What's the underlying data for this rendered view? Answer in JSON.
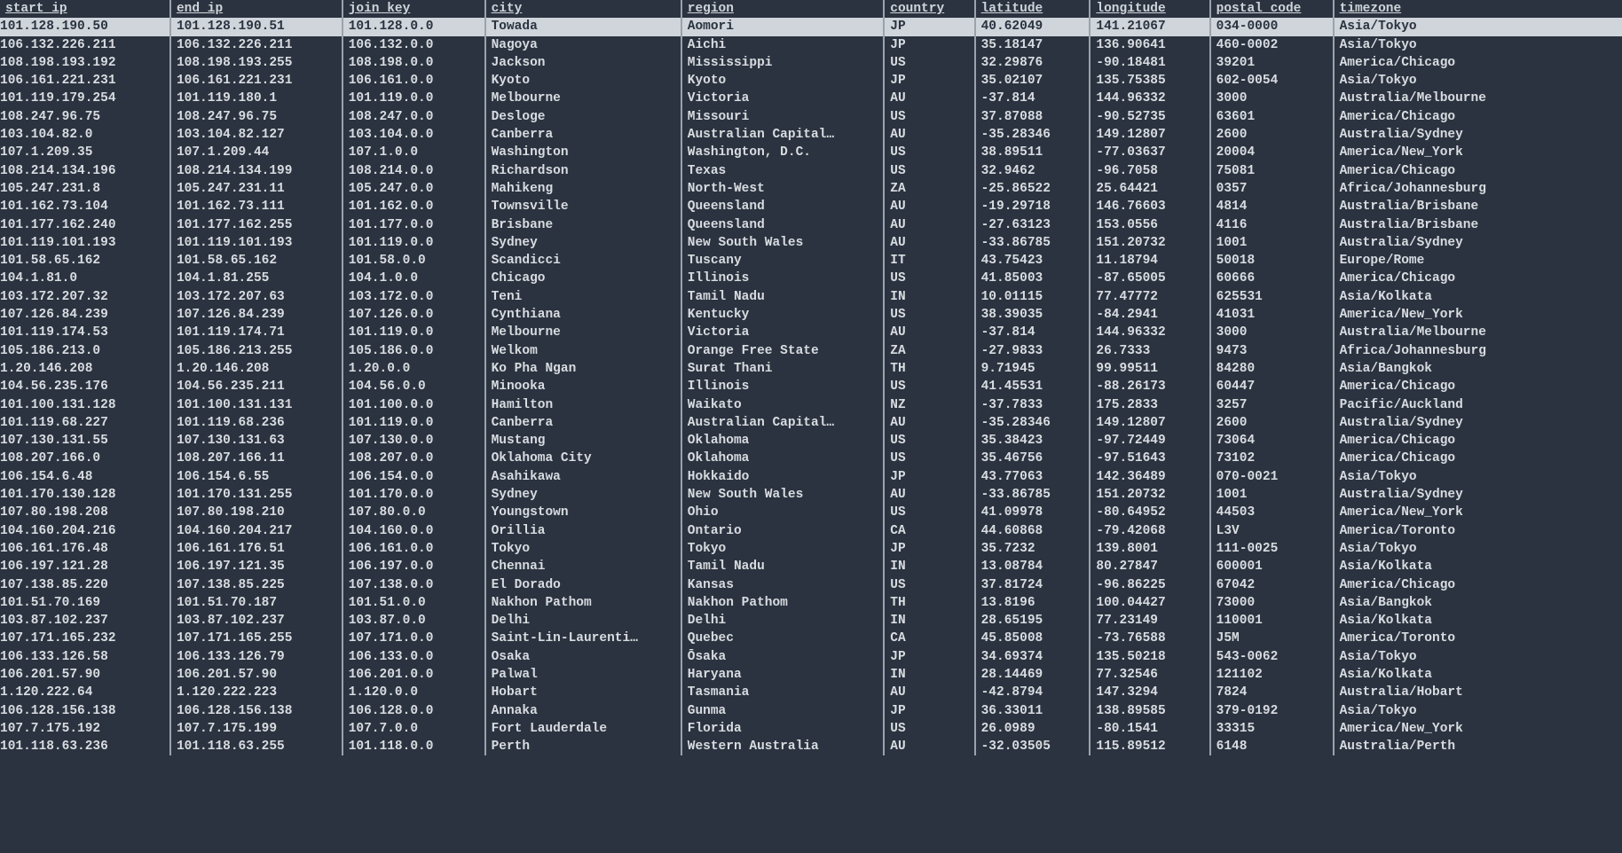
{
  "columns": [
    "start_ip",
    "end_ip",
    "join_key",
    "city",
    "region",
    "country",
    "latitude",
    "longitude",
    "postal_code",
    "timezone"
  ],
  "selected_index": 0,
  "rows": [
    {
      "start_ip": "101.128.190.50",
      "end_ip": "101.128.190.51",
      "join_key": "101.128.0.0",
      "city": "Towada",
      "region": "Aomori",
      "country": "JP",
      "latitude": "40.62049",
      "longitude": "141.21067",
      "postal_code": "034-0000",
      "timezone": "Asia/Tokyo"
    },
    {
      "start_ip": "106.132.226.211",
      "end_ip": "106.132.226.211",
      "join_key": "106.132.0.0",
      "city": "Nagoya",
      "region": "Aichi",
      "country": "JP",
      "latitude": "35.18147",
      "longitude": "136.90641",
      "postal_code": "460-0002",
      "timezone": "Asia/Tokyo"
    },
    {
      "start_ip": "108.198.193.192",
      "end_ip": "108.198.193.255",
      "join_key": "108.198.0.0",
      "city": "Jackson",
      "region": "Mississippi",
      "country": "US",
      "latitude": "32.29876",
      "longitude": "-90.18481",
      "postal_code": "39201",
      "timezone": "America/Chicago"
    },
    {
      "start_ip": "106.161.221.231",
      "end_ip": "106.161.221.231",
      "join_key": "106.161.0.0",
      "city": "Kyoto",
      "region": "Kyoto",
      "country": "JP",
      "latitude": "35.02107",
      "longitude": "135.75385",
      "postal_code": "602-0054",
      "timezone": "Asia/Tokyo"
    },
    {
      "start_ip": "101.119.179.254",
      "end_ip": "101.119.180.1",
      "join_key": "101.119.0.0",
      "city": "Melbourne",
      "region": "Victoria",
      "country": "AU",
      "latitude": "-37.814",
      "longitude": "144.96332",
      "postal_code": "3000",
      "timezone": "Australia/Melbourne"
    },
    {
      "start_ip": "108.247.96.75",
      "end_ip": "108.247.96.75",
      "join_key": "108.247.0.0",
      "city": "Desloge",
      "region": "Missouri",
      "country": "US",
      "latitude": "37.87088",
      "longitude": "-90.52735",
      "postal_code": "63601",
      "timezone": "America/Chicago"
    },
    {
      "start_ip": "103.104.82.0",
      "end_ip": "103.104.82.127",
      "join_key": "103.104.0.0",
      "city": "Canberra",
      "region": "Australian Capital…",
      "country": "AU",
      "latitude": "-35.28346",
      "longitude": "149.12807",
      "postal_code": "2600",
      "timezone": "Australia/Sydney"
    },
    {
      "start_ip": "107.1.209.35",
      "end_ip": "107.1.209.44",
      "join_key": "107.1.0.0",
      "city": "Washington",
      "region": "Washington, D.C.",
      "country": "US",
      "latitude": "38.89511",
      "longitude": "-77.03637",
      "postal_code": "20004",
      "timezone": "America/New_York"
    },
    {
      "start_ip": "108.214.134.196",
      "end_ip": "108.214.134.199",
      "join_key": "108.214.0.0",
      "city": "Richardson",
      "region": "Texas",
      "country": "US",
      "latitude": "32.9462",
      "longitude": "-96.7058",
      "postal_code": "75081",
      "timezone": "America/Chicago"
    },
    {
      "start_ip": "105.247.231.8",
      "end_ip": "105.247.231.11",
      "join_key": "105.247.0.0",
      "city": "Mahikeng",
      "region": "North-West",
      "country": "ZA",
      "latitude": "-25.86522",
      "longitude": "25.64421",
      "postal_code": "0357",
      "timezone": "Africa/Johannesburg"
    },
    {
      "start_ip": "101.162.73.104",
      "end_ip": "101.162.73.111",
      "join_key": "101.162.0.0",
      "city": "Townsville",
      "region": "Queensland",
      "country": "AU",
      "latitude": "-19.29718",
      "longitude": "146.76603",
      "postal_code": "4814",
      "timezone": "Australia/Brisbane"
    },
    {
      "start_ip": "101.177.162.240",
      "end_ip": "101.177.162.255",
      "join_key": "101.177.0.0",
      "city": "Brisbane",
      "region": "Queensland",
      "country": "AU",
      "latitude": "-27.63123",
      "longitude": "153.0556",
      "postal_code": "4116",
      "timezone": "Australia/Brisbane"
    },
    {
      "start_ip": "101.119.101.193",
      "end_ip": "101.119.101.193",
      "join_key": "101.119.0.0",
      "city": "Sydney",
      "region": "New South Wales",
      "country": "AU",
      "latitude": "-33.86785",
      "longitude": "151.20732",
      "postal_code": "1001",
      "timezone": "Australia/Sydney"
    },
    {
      "start_ip": "101.58.65.162",
      "end_ip": "101.58.65.162",
      "join_key": "101.58.0.0",
      "city": "Scandicci",
      "region": "Tuscany",
      "country": "IT",
      "latitude": "43.75423",
      "longitude": "11.18794",
      "postal_code": "50018",
      "timezone": "Europe/Rome"
    },
    {
      "start_ip": "104.1.81.0",
      "end_ip": "104.1.81.255",
      "join_key": "104.1.0.0",
      "city": "Chicago",
      "region": "Illinois",
      "country": "US",
      "latitude": "41.85003",
      "longitude": "-87.65005",
      "postal_code": "60666",
      "timezone": "America/Chicago"
    },
    {
      "start_ip": "103.172.207.32",
      "end_ip": "103.172.207.63",
      "join_key": "103.172.0.0",
      "city": "Teni",
      "region": "Tamil Nadu",
      "country": "IN",
      "latitude": "10.01115",
      "longitude": "77.47772",
      "postal_code": "625531",
      "timezone": "Asia/Kolkata"
    },
    {
      "start_ip": "107.126.84.239",
      "end_ip": "107.126.84.239",
      "join_key": "107.126.0.0",
      "city": "Cynthiana",
      "region": "Kentucky",
      "country": "US",
      "latitude": "38.39035",
      "longitude": "-84.2941",
      "postal_code": "41031",
      "timezone": "America/New_York"
    },
    {
      "start_ip": "101.119.174.53",
      "end_ip": "101.119.174.71",
      "join_key": "101.119.0.0",
      "city": "Melbourne",
      "region": "Victoria",
      "country": "AU",
      "latitude": "-37.814",
      "longitude": "144.96332",
      "postal_code": "3000",
      "timezone": "Australia/Melbourne"
    },
    {
      "start_ip": "105.186.213.0",
      "end_ip": "105.186.213.255",
      "join_key": "105.186.0.0",
      "city": "Welkom",
      "region": "Orange Free State",
      "country": "ZA",
      "latitude": "-27.9833",
      "longitude": "26.7333",
      "postal_code": "9473",
      "timezone": "Africa/Johannesburg"
    },
    {
      "start_ip": "1.20.146.208",
      "end_ip": "1.20.146.208",
      "join_key": "1.20.0.0",
      "city": "Ko Pha Ngan",
      "region": "Surat Thani",
      "country": "TH",
      "latitude": "9.71945",
      "longitude": "99.99511",
      "postal_code": "84280",
      "timezone": "Asia/Bangkok"
    },
    {
      "start_ip": "104.56.235.176",
      "end_ip": "104.56.235.211",
      "join_key": "104.56.0.0",
      "city": "Minooka",
      "region": "Illinois",
      "country": "US",
      "latitude": "41.45531",
      "longitude": "-88.26173",
      "postal_code": "60447",
      "timezone": "America/Chicago"
    },
    {
      "start_ip": "101.100.131.128",
      "end_ip": "101.100.131.131",
      "join_key": "101.100.0.0",
      "city": "Hamilton",
      "region": "Waikato",
      "country": "NZ",
      "latitude": "-37.7833",
      "longitude": "175.2833",
      "postal_code": "3257",
      "timezone": "Pacific/Auckland"
    },
    {
      "start_ip": "101.119.68.227",
      "end_ip": "101.119.68.236",
      "join_key": "101.119.0.0",
      "city": "Canberra",
      "region": "Australian Capital…",
      "country": "AU",
      "latitude": "-35.28346",
      "longitude": "149.12807",
      "postal_code": "2600",
      "timezone": "Australia/Sydney"
    },
    {
      "start_ip": "107.130.131.55",
      "end_ip": "107.130.131.63",
      "join_key": "107.130.0.0",
      "city": "Mustang",
      "region": "Oklahoma",
      "country": "US",
      "latitude": "35.38423",
      "longitude": "-97.72449",
      "postal_code": "73064",
      "timezone": "America/Chicago"
    },
    {
      "start_ip": "108.207.166.0",
      "end_ip": "108.207.166.11",
      "join_key": "108.207.0.0",
      "city": "Oklahoma City",
      "region": "Oklahoma",
      "country": "US",
      "latitude": "35.46756",
      "longitude": "-97.51643",
      "postal_code": "73102",
      "timezone": "America/Chicago"
    },
    {
      "start_ip": "106.154.6.48",
      "end_ip": "106.154.6.55",
      "join_key": "106.154.0.0",
      "city": "Asahikawa",
      "region": "Hokkaido",
      "country": "JP",
      "latitude": "43.77063",
      "longitude": "142.36489",
      "postal_code": "070-0021",
      "timezone": "Asia/Tokyo"
    },
    {
      "start_ip": "101.170.130.128",
      "end_ip": "101.170.131.255",
      "join_key": "101.170.0.0",
      "city": "Sydney",
      "region": "New South Wales",
      "country": "AU",
      "latitude": "-33.86785",
      "longitude": "151.20732",
      "postal_code": "1001",
      "timezone": "Australia/Sydney"
    },
    {
      "start_ip": "107.80.198.208",
      "end_ip": "107.80.198.210",
      "join_key": "107.80.0.0",
      "city": "Youngstown",
      "region": "Ohio",
      "country": "US",
      "latitude": "41.09978",
      "longitude": "-80.64952",
      "postal_code": "44503",
      "timezone": "America/New_York"
    },
    {
      "start_ip": "104.160.204.216",
      "end_ip": "104.160.204.217",
      "join_key": "104.160.0.0",
      "city": "Orillia",
      "region": "Ontario",
      "country": "CA",
      "latitude": "44.60868",
      "longitude": "-79.42068",
      "postal_code": "L3V",
      "timezone": "America/Toronto"
    },
    {
      "start_ip": "106.161.176.48",
      "end_ip": "106.161.176.51",
      "join_key": "106.161.0.0",
      "city": "Tokyo",
      "region": "Tokyo",
      "country": "JP",
      "latitude": "35.7232",
      "longitude": "139.8001",
      "postal_code": "111-0025",
      "timezone": "Asia/Tokyo"
    },
    {
      "start_ip": "106.197.121.28",
      "end_ip": "106.197.121.35",
      "join_key": "106.197.0.0",
      "city": "Chennai",
      "region": "Tamil Nadu",
      "country": "IN",
      "latitude": "13.08784",
      "longitude": "80.27847",
      "postal_code": "600001",
      "timezone": "Asia/Kolkata"
    },
    {
      "start_ip": "107.138.85.220",
      "end_ip": "107.138.85.225",
      "join_key": "107.138.0.0",
      "city": "El Dorado",
      "region": "Kansas",
      "country": "US",
      "latitude": "37.81724",
      "longitude": "-96.86225",
      "postal_code": "67042",
      "timezone": "America/Chicago"
    },
    {
      "start_ip": "101.51.70.169",
      "end_ip": "101.51.70.187",
      "join_key": "101.51.0.0",
      "city": "Nakhon Pathom",
      "region": "Nakhon Pathom",
      "country": "TH",
      "latitude": "13.8196",
      "longitude": "100.04427",
      "postal_code": "73000",
      "timezone": "Asia/Bangkok"
    },
    {
      "start_ip": "103.87.102.237",
      "end_ip": "103.87.102.237",
      "join_key": "103.87.0.0",
      "city": "Delhi",
      "region": "Delhi",
      "country": "IN",
      "latitude": "28.65195",
      "longitude": "77.23149",
      "postal_code": "110001",
      "timezone": "Asia/Kolkata"
    },
    {
      "start_ip": "107.171.165.232",
      "end_ip": "107.171.165.255",
      "join_key": "107.171.0.0",
      "city": "Saint-Lin-Laurenti…",
      "region": "Quebec",
      "country": "CA",
      "latitude": "45.85008",
      "longitude": "-73.76588",
      "postal_code": "J5M",
      "timezone": "America/Toronto"
    },
    {
      "start_ip": "106.133.126.58",
      "end_ip": "106.133.126.79",
      "join_key": "106.133.0.0",
      "city": "Osaka",
      "region": "Ōsaka",
      "country": "JP",
      "latitude": "34.69374",
      "longitude": "135.50218",
      "postal_code": "543-0062",
      "timezone": "Asia/Tokyo"
    },
    {
      "start_ip": "106.201.57.90",
      "end_ip": "106.201.57.90",
      "join_key": "106.201.0.0",
      "city": "Palwal",
      "region": "Haryana",
      "country": "IN",
      "latitude": "28.14469",
      "longitude": "77.32546",
      "postal_code": "121102",
      "timezone": "Asia/Kolkata"
    },
    {
      "start_ip": "1.120.222.64",
      "end_ip": "1.120.222.223",
      "join_key": "1.120.0.0",
      "city": "Hobart",
      "region": "Tasmania",
      "country": "AU",
      "latitude": "-42.8794",
      "longitude": "147.3294",
      "postal_code": "7824",
      "timezone": "Australia/Hobart"
    },
    {
      "start_ip": "106.128.156.138",
      "end_ip": "106.128.156.138",
      "join_key": "106.128.0.0",
      "city": "Annaka",
      "region": "Gunma",
      "country": "JP",
      "latitude": "36.33011",
      "longitude": "138.89585",
      "postal_code": "379-0192",
      "timezone": "Asia/Tokyo"
    },
    {
      "start_ip": "107.7.175.192",
      "end_ip": "107.7.175.199",
      "join_key": "107.7.0.0",
      "city": "Fort Lauderdale",
      "region": "Florida",
      "country": "US",
      "latitude": "26.0989",
      "longitude": "-80.1541",
      "postal_code": "33315",
      "timezone": "America/New_York"
    },
    {
      "start_ip": "101.118.63.236",
      "end_ip": "101.118.63.255",
      "join_key": "101.118.0.0",
      "city": "Perth",
      "region": "Western Australia",
      "country": "AU",
      "latitude": "-32.03505",
      "longitude": "115.89512",
      "postal_code": "6148",
      "timezone": "Australia/Perth"
    }
  ]
}
